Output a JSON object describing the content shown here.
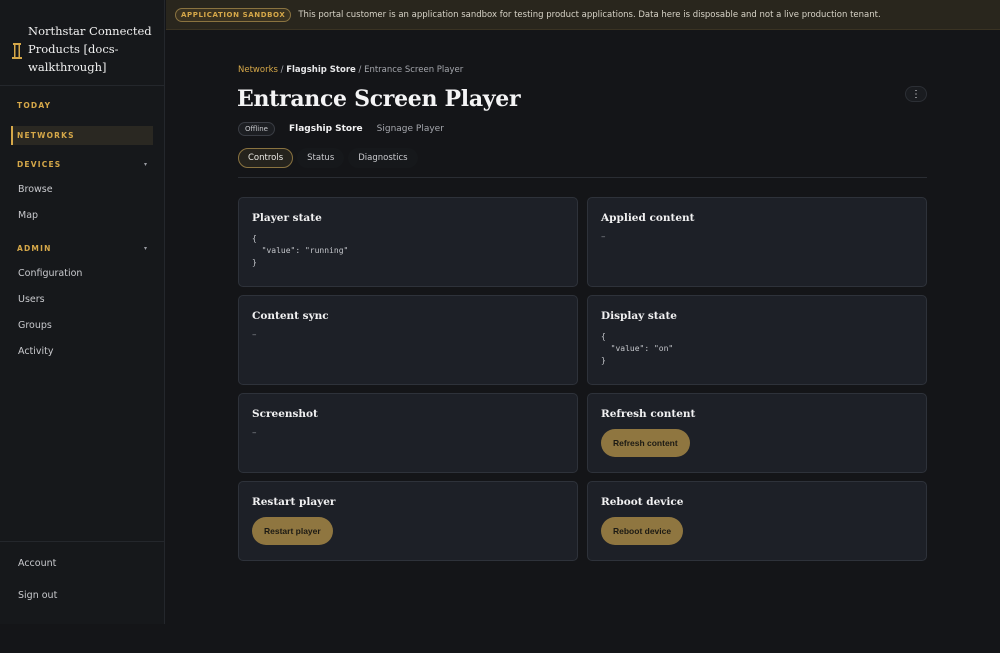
{
  "brand": {
    "name": "Northstar Connected Products [docs-walkthrough]"
  },
  "sidebar": {
    "today_label": "TODAY",
    "networks_label": "NETWORKS",
    "devices_label": "DEVICES",
    "devices_items": [
      "Browse",
      "Map"
    ],
    "admin_label": "ADMIN",
    "admin_items": [
      "Configuration",
      "Users",
      "Groups",
      "Activity"
    ],
    "account_label": "Account",
    "signout_label": "Sign out"
  },
  "banner": {
    "badge": "APPLICATION SANDBOX",
    "text": "This portal customer is an application sandbox for testing product applications. Data here is disposable and not a live production tenant."
  },
  "breadcrumb": {
    "networks": "Networks",
    "sep1": " / ",
    "store": "Flagship Store",
    "sep2": " / ",
    "current": "Entrance Screen Player"
  },
  "page": {
    "title": "Entrance Screen Player",
    "status": "Offline",
    "store": "Flagship Store",
    "device_type": "Signage Player",
    "more_icon": "kebab-icon"
  },
  "tabs": [
    "Controls",
    "Status",
    "Diagnostics"
  ],
  "cards": {
    "player_state": {
      "title": "Player state",
      "code": "{\n  \"value\": \"running\"\n}"
    },
    "applied_content": {
      "title": "Applied content",
      "value": "–"
    },
    "content_sync": {
      "title": "Content sync",
      "value": "–"
    },
    "display_state": {
      "title": "Display state",
      "code": "{\n  \"value\": \"on\"\n}"
    },
    "screenshot": {
      "title": "Screenshot",
      "value": "–"
    },
    "refresh_content": {
      "title": "Refresh content",
      "button": "Refresh content"
    },
    "restart_player": {
      "title": "Restart player",
      "button": "Restart player"
    },
    "reboot_device": {
      "title": "Reboot device",
      "button": "Reboot device"
    }
  },
  "colors": {
    "accent": "#d6a849",
    "button": "#8f7640",
    "card": "#1d2027"
  }
}
